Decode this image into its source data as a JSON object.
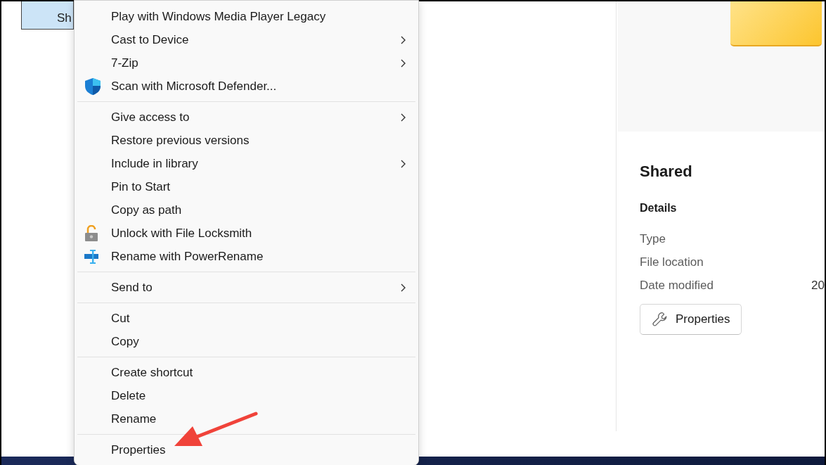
{
  "selected_file": {
    "label": "Sh",
    "selected": true
  },
  "context_menu": {
    "groups": [
      [
        {
          "label": "Play with Windows Media Player Legacy",
          "kind": "plain",
          "submenu": false
        },
        {
          "label": "Cast to Device",
          "kind": "plain",
          "submenu": true
        },
        {
          "label": "7-Zip",
          "kind": "plain",
          "submenu": true
        },
        {
          "label": "Scan with Microsoft Defender...",
          "kind": "shield",
          "submenu": false
        }
      ],
      [
        {
          "label": "Give access to",
          "kind": "plain",
          "submenu": true
        },
        {
          "label": "Restore previous versions",
          "kind": "plain",
          "submenu": false
        },
        {
          "label": "Include in library",
          "kind": "plain",
          "submenu": true
        },
        {
          "label": "Pin to Start",
          "kind": "plain",
          "submenu": false
        },
        {
          "label": "Copy as path",
          "kind": "plain",
          "submenu": false
        },
        {
          "label": "Unlock with File Locksmith",
          "kind": "lock",
          "submenu": false
        },
        {
          "label": "Rename with PowerRename",
          "kind": "rename",
          "submenu": false
        }
      ],
      [
        {
          "label": "Send to",
          "kind": "plain",
          "submenu": true
        }
      ],
      [
        {
          "label": "Cut",
          "kind": "plain",
          "submenu": false
        },
        {
          "label": "Copy",
          "kind": "plain",
          "submenu": false
        }
      ],
      [
        {
          "label": "Create shortcut",
          "kind": "plain",
          "submenu": false
        },
        {
          "label": "Delete",
          "kind": "plain",
          "submenu": false
        },
        {
          "label": "Rename",
          "kind": "plain",
          "submenu": false
        }
      ],
      [
        {
          "label": "Properties",
          "kind": "plain",
          "submenu": false
        }
      ]
    ]
  },
  "details_pane": {
    "title": "Shared",
    "section": "Details",
    "rows": [
      {
        "label": "Type",
        "value": ""
      },
      {
        "label": "File location",
        "value": ""
      },
      {
        "label": "Date modified",
        "value": "20"
      }
    ],
    "button": "Properties"
  }
}
